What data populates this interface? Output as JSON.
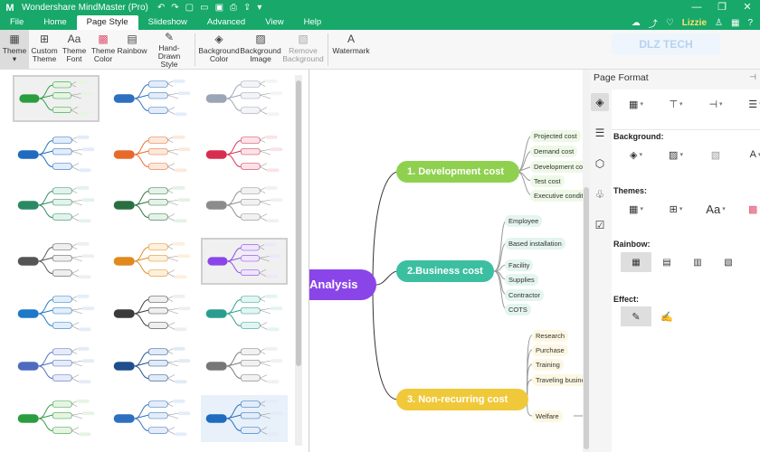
{
  "app": {
    "title": "Wondershare MindMaster (Pro)",
    "quick_icons": [
      "undo-icon",
      "redo-icon",
      "new-icon",
      "open-icon",
      "save-icon",
      "print-icon",
      "export-icon",
      "more-icon"
    ],
    "window_controls": [
      "—",
      "❐",
      "✕"
    ]
  },
  "menu": {
    "tabs": [
      "File",
      "Home",
      "Page Style",
      "Slideshow",
      "Advanced",
      "View",
      "Help"
    ],
    "active_tab": "Page Style",
    "user": "Lizzie"
  },
  "ribbon": {
    "theme": "Theme",
    "custom_theme": "Custom Theme",
    "theme_font": "Theme Font",
    "theme_color": "Theme Color",
    "rainbow": "Rainbow",
    "hand_drawn_style": "Hand-Drawn Style",
    "background_color": "Background Color",
    "background_image": "Background Image",
    "remove_background": "Remove Background",
    "watermark": "Watermark",
    "watermark_logo": "DLZ TECH"
  },
  "gallery": {
    "themes": [
      {
        "color": "#2a9d3f",
        "accent": "#e7f4e2"
      },
      {
        "color": "#2f6fbf",
        "accent": "#e3edf9"
      },
      {
        "color": "#9aa5b5",
        "accent": "#f2f4f7"
      },
      {
        "color": "#1e6bbf",
        "accent": "#e3ecf8"
      },
      {
        "color": "#e76a2b",
        "accent": "#fde9dc"
      },
      {
        "color": "#d62e4f",
        "accent": "#fbe3e8"
      },
      {
        "color": "#2a8a63",
        "accent": "#e3f3eb"
      },
      {
        "color": "#2a6f3f",
        "accent": "#e5f2e7"
      },
      {
        "color": "#8c8c8c",
        "accent": "#f1f1f1"
      },
      {
        "color": "#555555",
        "accent": "#efefef"
      },
      {
        "color": "#e08a1e",
        "accent": "#fdf0dc"
      },
      {
        "color": "#8a45e8",
        "accent": "#efe5fd"
      },
      {
        "color": "#1e78c8",
        "accent": "#e3eef9"
      },
      {
        "color": "#3a3a3a",
        "accent": "#efefef"
      },
      {
        "color": "#2a9d8f",
        "accent": "#e3f4f1"
      },
      {
        "color": "#4e6bbf",
        "accent": "#e6ebf7"
      },
      {
        "color": "#1f4e8c",
        "accent": "#e2eaf5"
      },
      {
        "color": "#777777",
        "accent": "#f1f1f1"
      },
      {
        "color": "#2a9d3f",
        "accent": "#e7f4e2"
      },
      {
        "color": "#2f6fbf",
        "accent": "#e3edf9"
      },
      {
        "color": "#1e6bbf",
        "accent": "#e3ecf8"
      }
    ]
  },
  "canvas": {
    "main_topic": "Analysis",
    "topics": [
      {
        "label": "1. Development cost",
        "color": "#8fd14f",
        "subs": [
          "Projected cost",
          "Demand cost",
          "Development cost",
          "Test cost",
          "Executive condition"
        ]
      },
      {
        "label": "2.Business cost",
        "color": "#3cbfa0",
        "subs": [
          "Employee",
          "Based installation",
          "Facility",
          "Supplies",
          "Contractor",
          "COTS"
        ]
      },
      {
        "label": "3. Non-recurring cost",
        "color": "#f0c93a",
        "subs": [
          "Research",
          "Purchase",
          "Training",
          "Traveling business",
          "Welfare"
        ]
      }
    ]
  },
  "format_panel": {
    "title": "Page Format",
    "background_label": "Background:",
    "themes_label": "Themes:",
    "rainbow_label": "Rainbow:",
    "effect_label": "Effect:"
  }
}
